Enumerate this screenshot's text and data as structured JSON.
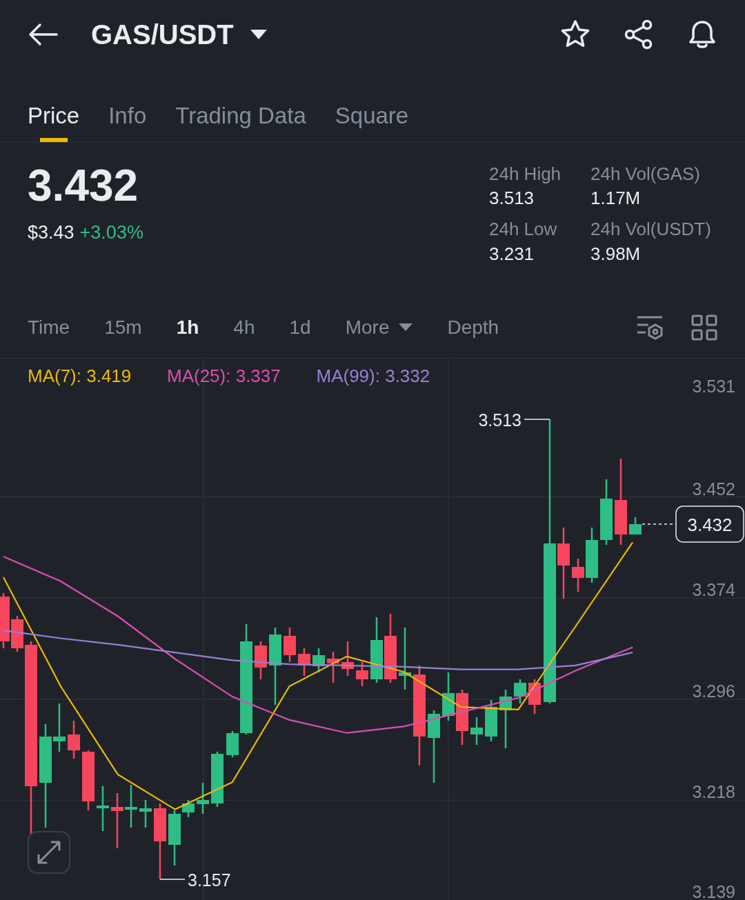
{
  "header": {
    "title": "GAS/USDT"
  },
  "tabs": [
    {
      "label": "Price",
      "selected": true
    },
    {
      "label": "Info",
      "selected": false
    },
    {
      "label": "Trading Data",
      "selected": false
    },
    {
      "label": "Square",
      "selected": false
    }
  ],
  "ticker": {
    "price": "3.432",
    "fiat_price": "$3.43",
    "change": "+3.03%"
  },
  "stats": [
    {
      "label": "24h High",
      "value": "3.513"
    },
    {
      "label": "24h Vol(GAS)",
      "value": "1.17M"
    },
    {
      "label": "24h Low",
      "value": "3.231"
    },
    {
      "label": "24h Vol(USDT)",
      "value": "3.98M"
    }
  ],
  "intervals": [
    {
      "label": "Time",
      "selected": false,
      "kind": "plain"
    },
    {
      "label": "15m",
      "selected": false,
      "kind": "plain"
    },
    {
      "label": "1h",
      "selected": true,
      "kind": "plain"
    },
    {
      "label": "4h",
      "selected": false,
      "kind": "plain"
    },
    {
      "label": "1d",
      "selected": false,
      "kind": "plain"
    },
    {
      "label": "More",
      "selected": false,
      "kind": "dropdown"
    },
    {
      "label": "Depth",
      "selected": false,
      "kind": "plain"
    }
  ],
  "chart": {
    "chart_data": {
      "type": "line",
      "grid": true,
      "yticks": [
        3.531,
        3.452,
        3.374,
        3.296,
        3.218,
        3.139
      ],
      "ylim": [
        3.139,
        3.531
      ],
      "series": [
        {
          "name": "MA(7): 3.419",
          "color": "#f0b90b",
          "values": [
            3.39,
            3.306,
            3.238,
            3.211,
            3.232,
            3.306,
            3.329,
            3.317,
            3.29,
            3.288,
            3.352,
            3.417
          ]
        },
        {
          "name": "MA(25): 3.337",
          "color": "#d94fb1",
          "values": [
            3.406,
            3.387,
            3.36,
            3.327,
            3.298,
            3.28,
            3.27,
            3.275,
            3.286,
            3.297,
            3.318,
            3.336
          ]
        },
        {
          "name": "MA(99): 3.332",
          "color": "#9b7fd6",
          "values": [
            3.349,
            3.343,
            3.338,
            3.332,
            3.326,
            3.323,
            3.322,
            3.321,
            3.319,
            3.319,
            3.322,
            3.332
          ]
        }
      ]
    },
    "high_label": "3.513",
    "low_label": "3.157",
    "last_price": "3.432"
  }
}
